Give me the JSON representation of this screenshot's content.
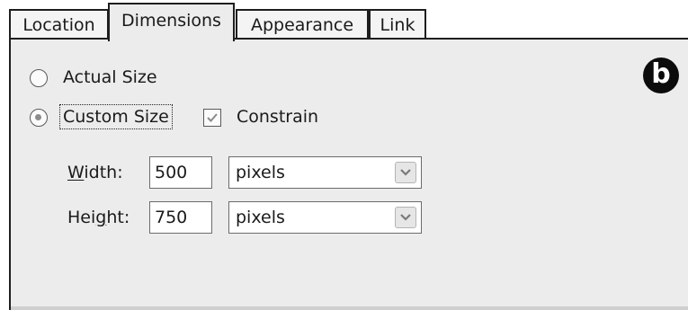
{
  "tabs": [
    {
      "label": "Location",
      "active": false
    },
    {
      "label": "Dimensions",
      "active": true
    },
    {
      "label": "Appearance",
      "active": false
    },
    {
      "label": "Link",
      "active": false
    }
  ],
  "panel": {
    "badge": "b",
    "actual_size": {
      "label": "Actual Size",
      "selected": false
    },
    "custom_size": {
      "label": "Custom Size",
      "selected": true
    },
    "constrain": {
      "label": "Constrain",
      "checked": true
    },
    "width": {
      "mnemonic": "W",
      "rest": "idth:",
      "value": "500",
      "unit": "pixels"
    },
    "height": {
      "pre": "Hei",
      "mnemonic": "g",
      "rest": "ht:",
      "value": "750",
      "unit": "pixels"
    }
  },
  "icons": {
    "radio_dot": "radio-dot",
    "check": "check-icon",
    "dropdown": "chevron-down-icon"
  }
}
